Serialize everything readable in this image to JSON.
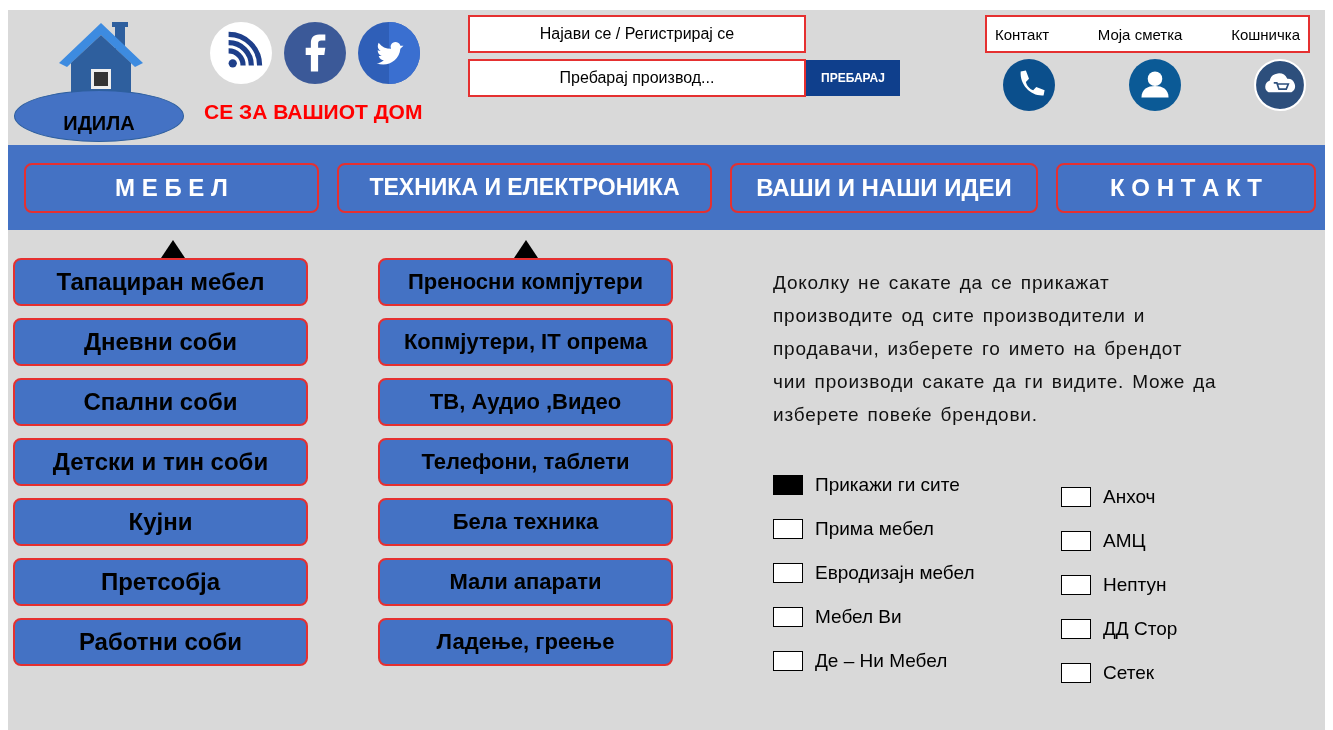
{
  "logo": {
    "name": "ИДИЛА"
  },
  "tagline": "СЕ ЗА ВАШИОТ ДОМ",
  "social": [
    {
      "kind": "rss"
    },
    {
      "kind": "facebook"
    },
    {
      "kind": "twitter"
    }
  ],
  "login": "Најави се / Регистрирај се",
  "search": {
    "placeholder": "Пребарај производ...",
    "button": "ПРЕБАРАЈ"
  },
  "top_links": [
    {
      "label": "Контакт",
      "kind": "phone"
    },
    {
      "label": "Моја сметка",
      "kind": "user"
    },
    {
      "label": "Кошничка",
      "kind": "cart"
    }
  ],
  "nav": [
    {
      "label": "М Е Б Е Л",
      "children": [
        "Тапациран мебел",
        "Дневни соби",
        "Спални соби",
        "Детски и тин соби",
        "Кујни",
        "Претсобја",
        "Работни соби"
      ]
    },
    {
      "label": "ТЕХНИКА И ЕЛЕКТРОНИКА",
      "children": [
        "Преносни компјутери",
        "Копмјутери,  IT опрема",
        "ТВ, Аудио ,Видео",
        "Телефони, таблети",
        "Бела техника",
        "Мали апарати",
        "Ладење, греење"
      ]
    },
    {
      "label": "ВАШИ И НАШИ ИДЕИ"
    },
    {
      "label": "К О Н Т А К Т"
    }
  ],
  "filter": {
    "text": "Доколку не сакате да се прикажат производите од сите производители и продавачи, изберете го името на брендот чии производи сакате да ги видите. Може да изберете повеќе  брендови.",
    "columns": [
      [
        {
          "label": "Прикажи ги сите",
          "checked": true
        },
        {
          "label": "Прима мебел",
          "checked": false
        },
        {
          "label": "Евродизајн мебел",
          "checked": false
        },
        {
          "label": "Мебел Ви",
          "checked": false
        },
        {
          "label": "Де – Ни Мебел",
          "checked": false
        }
      ],
      [
        {
          "label": "Анхоч",
          "checked": false
        },
        {
          "label": "АМЦ",
          "checked": false
        },
        {
          "label": "Нептун",
          "checked": false
        },
        {
          "label": "ДД Стор",
          "checked": false
        },
        {
          "label": "Сетек",
          "checked": false
        }
      ]
    ]
  }
}
